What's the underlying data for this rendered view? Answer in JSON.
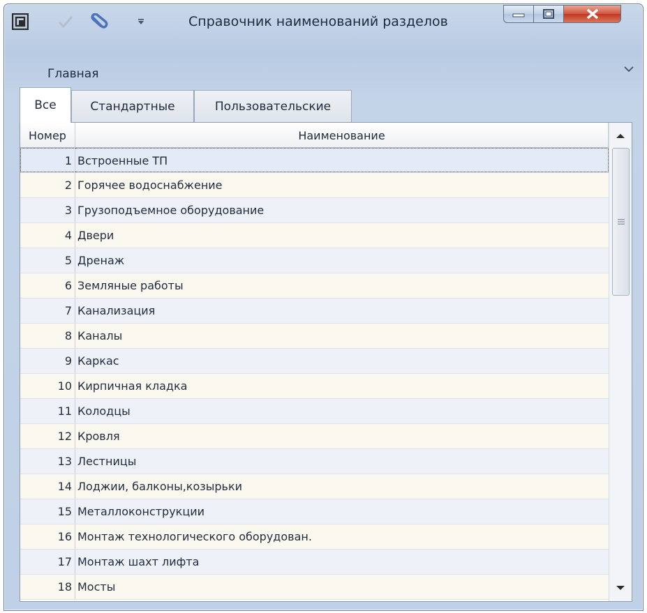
{
  "window": {
    "title": "Справочник наименований разделов",
    "accent_color": "#c9d7ea",
    "close_color": "#c2381f"
  },
  "quick_access": {
    "icons": [
      "app-icon",
      "check-icon",
      "paperclip-icon",
      "dropdown-icon"
    ]
  },
  "ribbon": {
    "tab_label": "Главная"
  },
  "tabs": [
    {
      "label": "Все",
      "active": true
    },
    {
      "label": "Стандартные",
      "active": false
    },
    {
      "label": "Пользовательские",
      "active": false
    }
  ],
  "grid": {
    "columns": [
      "Номер",
      "Наименование"
    ],
    "rows": [
      {
        "num": "1",
        "name": "Встроенные ТП",
        "selected": true
      },
      {
        "num": "2",
        "name": "Горячее водоснабжение"
      },
      {
        "num": "3",
        "name": "Грузоподъемное оборудование"
      },
      {
        "num": "4",
        "name": "Двери"
      },
      {
        "num": "5",
        "name": "Дренаж"
      },
      {
        "num": "6",
        "name": "Земляные работы"
      },
      {
        "num": "7",
        "name": "Канализация"
      },
      {
        "num": "8",
        "name": "Каналы"
      },
      {
        "num": "9",
        "name": "Каркас"
      },
      {
        "num": "10",
        "name": "Кирпичная кладка"
      },
      {
        "num": "11",
        "name": "Колодцы"
      },
      {
        "num": "12",
        "name": "Кровля"
      },
      {
        "num": "13",
        "name": "Лестницы"
      },
      {
        "num": "14",
        "name": "Лоджии, балконы,козырьки"
      },
      {
        "num": "15",
        "name": "Металлоконструкции"
      },
      {
        "num": "16",
        "name": "Монтаж технологического оборудован."
      },
      {
        "num": "17",
        "name": "Монтаж шахт лифта"
      },
      {
        "num": "18",
        "name": "Мосты"
      }
    ]
  }
}
